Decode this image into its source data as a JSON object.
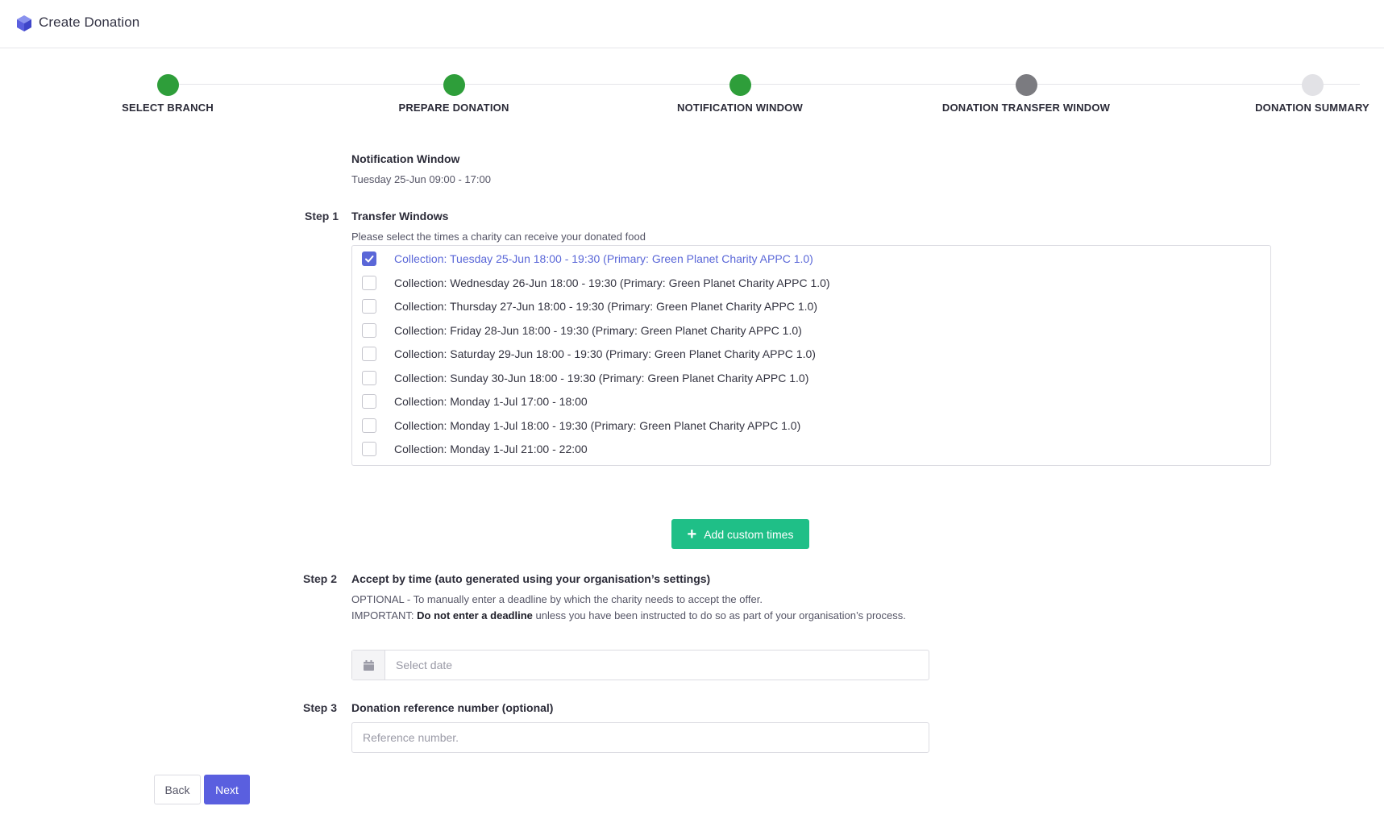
{
  "header": {
    "title": "Create Donation",
    "logo_icon": "cube-icon"
  },
  "stepper": {
    "steps": [
      {
        "label": "SELECT BRANCH",
        "status": "complete",
        "color": "#2e9e3a"
      },
      {
        "label": "PREPARE DONATION",
        "status": "complete",
        "color": "#2e9e3a"
      },
      {
        "label": "NOTIFICATION WINDOW",
        "status": "current",
        "color": "#2e9e3a"
      },
      {
        "label": "DONATION TRANSFER WINDOW",
        "status": "next",
        "color": "#7b7b80"
      },
      {
        "label": "DONATION SUMMARY",
        "status": "pending",
        "color": "#e2e2e6"
      }
    ]
  },
  "notification": {
    "heading": "Notification Window",
    "value": "Tuesday 25-Jun 09:00 - 17:00"
  },
  "step1": {
    "label": "Step 1",
    "heading": "Transfer Windows",
    "instructions": "Please select the times a charity can receive your donated food",
    "windows": [
      {
        "label": "Collection: Tuesday 25-Jun 18:00 - 19:30 (Primary: Green Planet Charity APPC 1.0)",
        "checked": true
      },
      {
        "label": "Collection: Wednesday 26-Jun 18:00 - 19:30 (Primary: Green Planet Charity APPC 1.0)",
        "checked": false
      },
      {
        "label": "Collection: Thursday 27-Jun 18:00 - 19:30 (Primary: Green Planet Charity APPC 1.0)",
        "checked": false
      },
      {
        "label": "Collection: Friday 28-Jun 18:00 - 19:30 (Primary: Green Planet Charity APPC 1.0)",
        "checked": false
      },
      {
        "label": "Collection: Saturday 29-Jun 18:00 - 19:30 (Primary: Green Planet Charity APPC 1.0)",
        "checked": false
      },
      {
        "label": "Collection: Sunday 30-Jun 18:00 - 19:30 (Primary: Green Planet Charity APPC 1.0)",
        "checked": false
      },
      {
        "label": "Collection: Monday 1-Jul 17:00 - 18:00",
        "checked": false
      },
      {
        "label": "Collection: Monday 1-Jul 18:00 - 19:30 (Primary: Green Planet Charity APPC 1.0)",
        "checked": false
      },
      {
        "label": "Collection: Monday 1-Jul 21:00 - 22:00",
        "checked": false
      }
    ],
    "add_button_label": "Add custom times"
  },
  "step2": {
    "label": "Step 2",
    "heading": "Accept by time (auto generated using your organisation’s settings)",
    "optional_note": "OPTIONAL - To manually enter a deadline by which the charity needs to accept the offer.",
    "important_prefix": "IMPORTANT: ",
    "important_bold": "Do not enter a deadline",
    "important_rest": " unless you have been instructed to do so as part of your organisation’s process.",
    "date_placeholder": "Select date"
  },
  "step3": {
    "label": "Step 3",
    "heading": "Donation reference number (optional)",
    "ref_placeholder": "Reference number."
  },
  "footer": {
    "back_label": "Back",
    "next_label": "Next"
  },
  "colors": {
    "accent": "#5a5fdf",
    "success": "#1fbf87",
    "complete": "#2e9e3a"
  }
}
